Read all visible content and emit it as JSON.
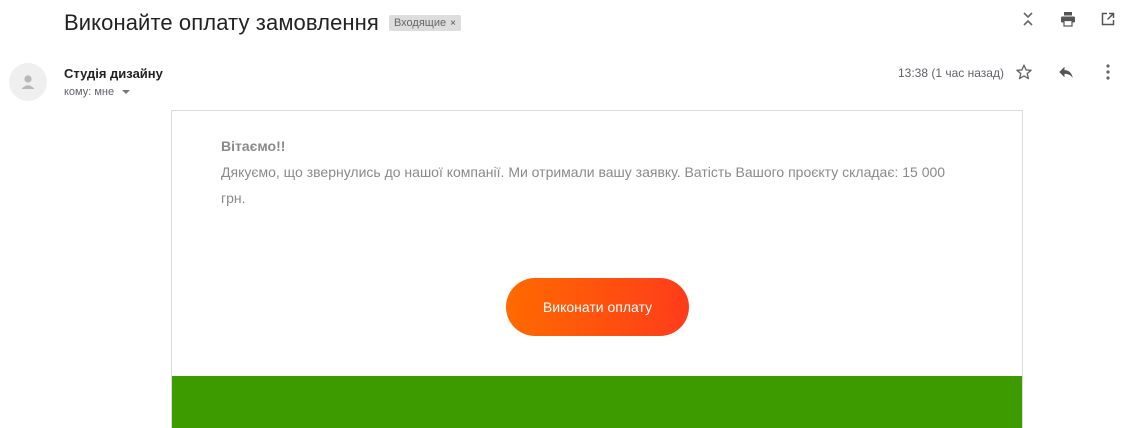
{
  "subject": {
    "title": "Виконайте оплату замовлення",
    "label": "Входящие",
    "label_remove": "×"
  },
  "message": {
    "sender_name": "Студія дизайну",
    "recipient": "кому: мне",
    "time": "13:38 (1 час назад)"
  },
  "email_body": {
    "greeting": "Вітаємо!!",
    "text": "Дякуємо, що звернулись до нашої компанії. Ми отримали вашу заявку. Ватість Вашого проєкту складає: 15 000 грн.",
    "button_label": "Виконати оплату"
  },
  "colors": {
    "button_gradient_start": "#ff6a00",
    "button_gradient_end": "#ff3c1a",
    "footer_band": "#3d9b00",
    "body_text": "#8a8a8a"
  },
  "icons": {
    "top": [
      "expand-collapse-icon",
      "print-icon",
      "open-in-new-window-icon"
    ],
    "message": [
      "star-icon",
      "reply-icon",
      "more-options-icon"
    ]
  }
}
